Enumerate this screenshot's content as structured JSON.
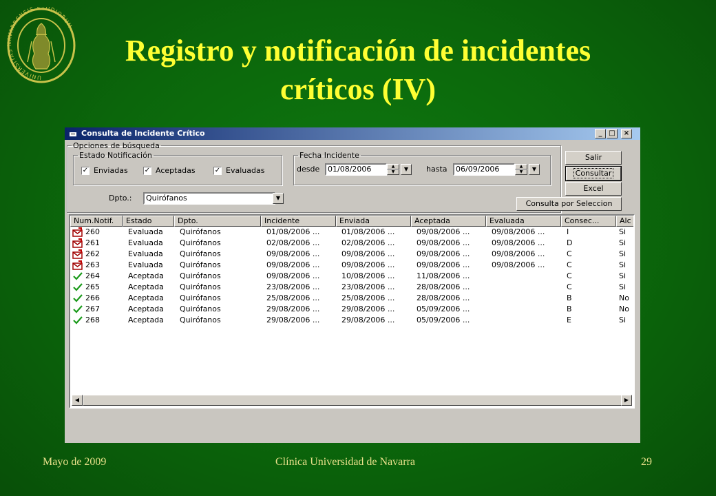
{
  "slide": {
    "title_line1": "Registro y notificación de incidentes",
    "title_line2": "críticos (IV)",
    "footer_left": "Mayo de 2009",
    "footer_center": "Clínica Universidad de Navarra",
    "footer_right": "29",
    "seal_text": "UNIVERSITAS NAVARRENSIS STUDIORUM",
    "colors": {
      "background": "#0b6a0b",
      "title": "#ffff33",
      "footer": "#e8e08a"
    }
  },
  "window": {
    "title": "Consulta de Incidente Crítico",
    "controls": {
      "minimize": "_",
      "maximize": "□",
      "close": "×"
    },
    "search_options": {
      "legend": "Opciones de búsqueda",
      "estado": {
        "legend": "Estado Notificación",
        "options": [
          {
            "label": "Enviadas",
            "checked": true
          },
          {
            "label": "Aceptadas",
            "checked": true
          },
          {
            "label": "Evaluadas",
            "checked": true
          }
        ]
      },
      "fecha": {
        "legend": "Fecha Incidente",
        "desde_label": "desde",
        "desde_value": "01/08/2006",
        "hasta_label": "hasta",
        "hasta_value": "06/09/2006"
      },
      "dpto": {
        "label": "Dpto.:",
        "value": "Quirófanos"
      }
    },
    "buttons": {
      "salir": "Salir",
      "consultar": "Consultar",
      "excel": "Excel",
      "consulta_seleccion": "Consulta por Seleccion"
    },
    "table": {
      "columns": [
        "Num.Notif.",
        "Estado",
        "Dpto.",
        "Incidente",
        "Enviada",
        "Aceptada",
        "Evaluada",
        "Consec...",
        "Alc"
      ],
      "rows": [
        {
          "icon": "envelope-icon",
          "cells": [
            "260",
            "Evaluada",
            "Quirófanos",
            "01/08/2006 ...",
            "01/08/2006 ...",
            "09/08/2006 ...",
            "09/08/2006 ...",
            "I",
            "Si"
          ]
        },
        {
          "icon": "envelope-icon",
          "cells": [
            "261",
            "Evaluada",
            "Quirófanos",
            "02/08/2006 ...",
            "02/08/2006 ...",
            "09/08/2006 ...",
            "09/08/2006 ...",
            "D",
            "Si"
          ]
        },
        {
          "icon": "envelope-icon",
          "cells": [
            "262",
            "Evaluada",
            "Quirófanos",
            "09/08/2006 ...",
            "09/08/2006 ...",
            "09/08/2006 ...",
            "09/08/2006 ...",
            "C",
            "Si"
          ]
        },
        {
          "icon": "envelope-icon",
          "cells": [
            "263",
            "Evaluada",
            "Quirófanos",
            "09/08/2006 ...",
            "09/08/2006 ...",
            "09/08/2006 ...",
            "09/08/2006 ...",
            "C",
            "Si"
          ]
        },
        {
          "icon": "checkmark-icon",
          "cells": [
            "264",
            "Aceptada",
            "Quirófanos",
            "09/08/2006 ...",
            "10/08/2006 ...",
            "11/08/2006 ...",
            "",
            "C",
            "Si"
          ]
        },
        {
          "icon": "checkmark-icon",
          "cells": [
            "265",
            "Aceptada",
            "Quirófanos",
            "23/08/2006 ...",
            "23/08/2006 ...",
            "28/08/2006 ...",
            "",
            "C",
            "Si"
          ]
        },
        {
          "icon": "checkmark-icon",
          "cells": [
            "266",
            "Aceptada",
            "Quirófanos",
            "25/08/2006 ...",
            "25/08/2006 ...",
            "28/08/2006 ...",
            "",
            "B",
            "No"
          ]
        },
        {
          "icon": "checkmark-icon",
          "cells": [
            "267",
            "Aceptada",
            "Quirófanos",
            "29/08/2006 ...",
            "29/08/2006 ...",
            "05/09/2006 ...",
            "",
            "B",
            "No"
          ]
        },
        {
          "icon": "checkmark-icon",
          "cells": [
            "268",
            "Aceptada",
            "Quirófanos",
            "29/08/2006 ...",
            "29/08/2006 ...",
            "05/09/2006 ...",
            "",
            "E",
            "Si"
          ]
        }
      ]
    }
  }
}
